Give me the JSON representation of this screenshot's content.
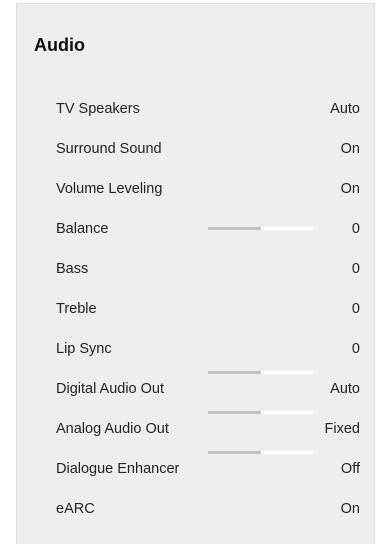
{
  "title": "Audio",
  "rows": [
    {
      "label": "TV Speakers",
      "value": "Auto"
    },
    {
      "label": "Surround Sound",
      "value": "On"
    },
    {
      "label": "Volume Leveling",
      "value": "On"
    },
    {
      "label": "Balance",
      "value": "0"
    },
    {
      "label": "Bass",
      "value": "0"
    },
    {
      "label": "Treble",
      "value": "0"
    },
    {
      "label": "Lip Sync",
      "value": "0"
    },
    {
      "label": "Digital Audio Out",
      "value": "Auto"
    },
    {
      "label": "Analog Audio Out",
      "value": "Fixed"
    },
    {
      "label": "Dialogue Enhancer",
      "value": "Off"
    },
    {
      "label": "eARC",
      "value": "On"
    }
  ],
  "sliders": {
    "balance": {
      "level": 0.5
    },
    "digital_audio_out": {
      "level": 0.5
    },
    "analog_audio_out": {
      "level": 0.5
    },
    "dialogue_enhancer": {
      "level": 0.5
    }
  }
}
